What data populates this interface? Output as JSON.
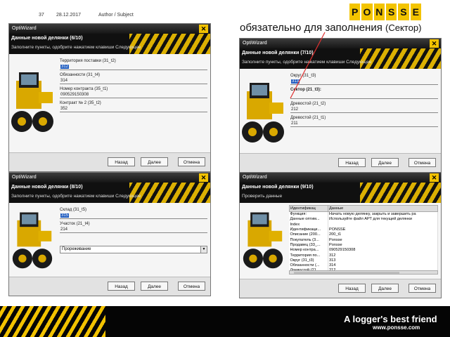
{
  "header": {
    "page_num": "37",
    "date": "28.12.2017",
    "author": "Author / Subject"
  },
  "logo": {
    "letters": [
      "P",
      "O",
      "N",
      "S",
      "S",
      "E"
    ]
  },
  "headline": {
    "main": "обязательно для заполнения",
    "suffix": "(Сектор)"
  },
  "colors": {
    "brand_yellow": "#f2c200",
    "selection_blue": "#1e5bbf"
  },
  "window_title": "OptiWizard",
  "buttons": {
    "back": "Назад",
    "next": "Далее",
    "cancel": "Отмена"
  },
  "win1": {
    "title": "Данные новой делянки (6/10)",
    "subtitle": "Заполните пункты, одобрите нажатием клавиши Следующее",
    "fields": [
      {
        "label": "Территория поставки (31_t2)",
        "value": "312"
      },
      {
        "label": "Обязанности (31_t4)",
        "value": "314"
      },
      {
        "label": "Номер контракта (35_t1)",
        "value": "090529150308"
      },
      {
        "label": "Контракт № 2 (35_t2)",
        "value": "352"
      }
    ]
  },
  "win2": {
    "title": "Данные новой делянки (7/10)",
    "subtitle": "Заполните пункты, одобрите нажатием клавиши Следующее",
    "fields": [
      {
        "label": "Округ (31_t3)",
        "value": "313"
      },
      {
        "label": "Сектор (21_t3):",
        "value": ""
      },
      {
        "label": "Древостой (21_t2)",
        "value": "212"
      },
      {
        "label": "Древостой (21_t1)",
        "value": "211"
      }
    ]
  },
  "win3": {
    "title": "Данные новой делянки (8/10)",
    "subtitle": "Заполните пункты, одобрите нажатием клавиши Следующее",
    "fields": [
      {
        "label": "Склад (31_t5)",
        "value": "315"
      },
      {
        "label": "Участок (21_t4)",
        "value": "214"
      }
    ],
    "dropdown": "Прореживание"
  },
  "win4": {
    "title": "Данные новой делянки (9/10)",
    "subtitle": "Проверить данные",
    "table": {
      "headers": [
        "Идентификац",
        "Данные"
      ],
      "rows": [
        [
          "Функция:",
          "Начать новую делянку, закрыть и завершить ра"
        ],
        [
          "Данные оптим...",
          "Используйте файл АРТ для текущей делянки"
        ],
        [
          "Index",
          ""
        ],
        [
          "Идентификаци...",
          "PONSSE"
        ],
        [
          "Описание (200...",
          "200_t1"
        ],
        [
          "Покупатель (3...",
          "Ponsse"
        ],
        [
          "Продавец (33_...",
          "Ponsse"
        ],
        [
          "Номер контра...",
          "090529150308"
        ],
        [
          "Территория по...",
          "312"
        ],
        [
          "Округ (31_t3)",
          "313"
        ],
        [
          "Обязанности (...",
          "314"
        ],
        [
          "Древостой (21...",
          "212"
        ]
      ]
    }
  },
  "footer": {
    "slogan": "A logger's best friend",
    "url": "www.ponsse.com"
  }
}
